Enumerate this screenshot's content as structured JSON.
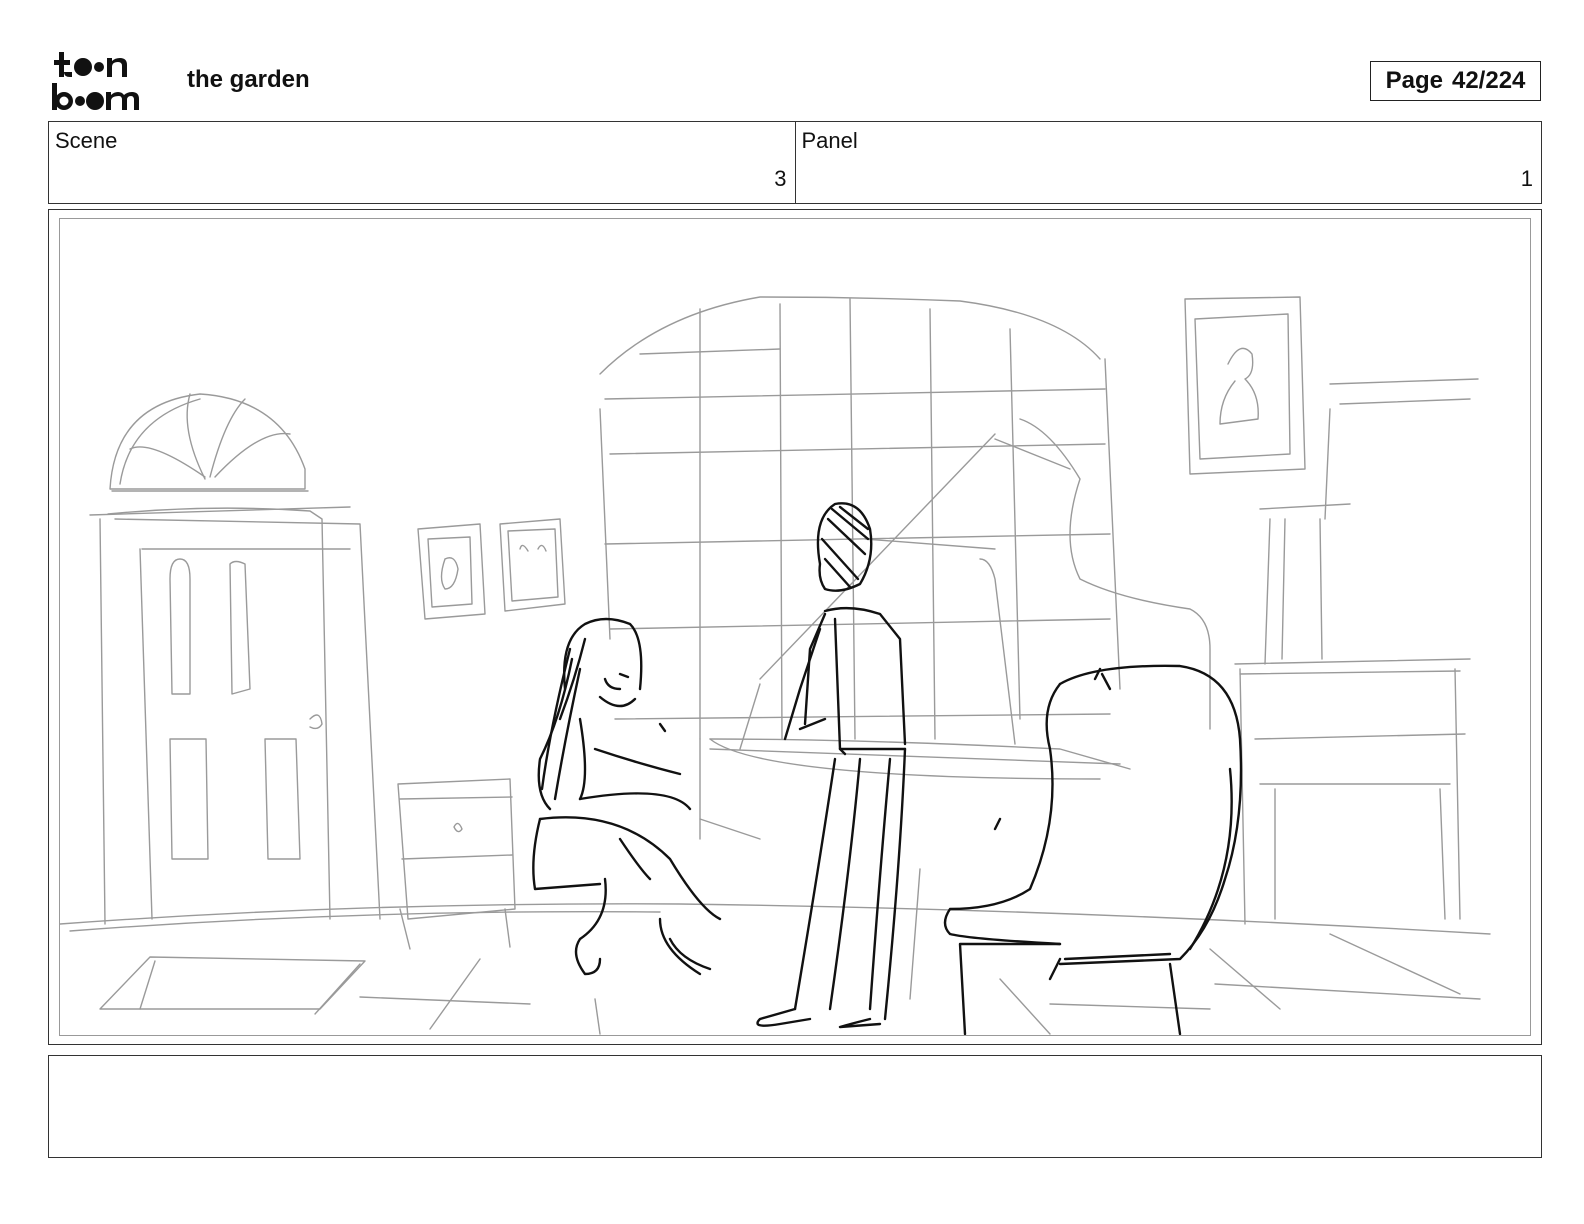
{
  "header": {
    "logo": {
      "brand": "toon boom",
      "line1": "toon",
      "line2": "boom"
    },
    "project_title": "the garden",
    "page": {
      "label": "Page",
      "value": "42/224"
    }
  },
  "info": {
    "scene": {
      "label": "Scene",
      "value": "3"
    },
    "panel": {
      "label": "Panel",
      "value": "1"
    }
  },
  "panel_image": {
    "icon": "storyboard-sketch",
    "sketch_color": "#000000",
    "background_color": "#9a9a9a"
  },
  "notes": {
    "text": ""
  }
}
